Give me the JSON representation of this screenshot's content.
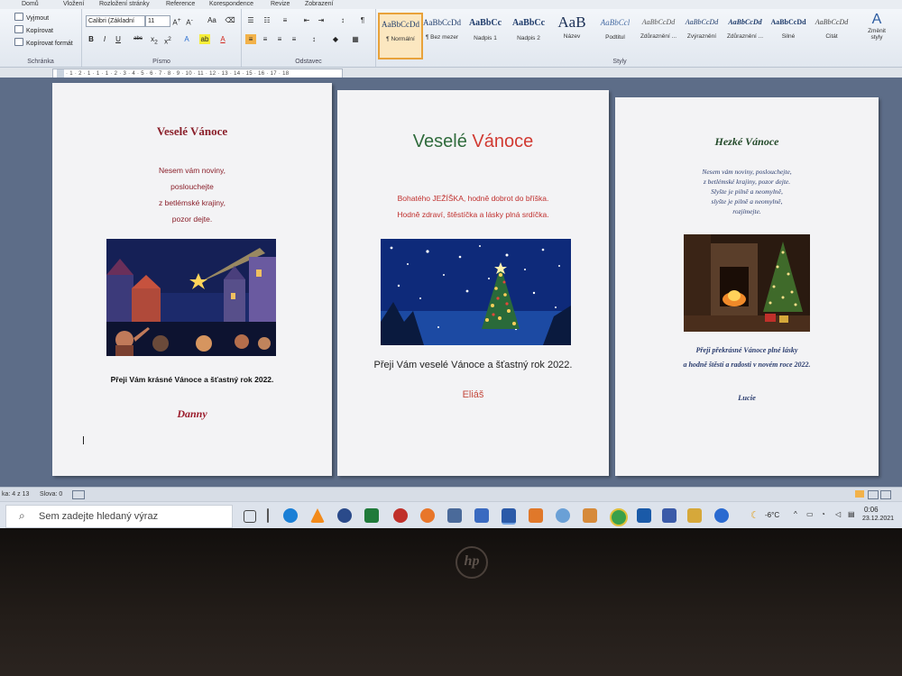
{
  "ribbon": {
    "tabs": [
      "Domů",
      "Vložení",
      "Rozložení stránky",
      "Reference",
      "Korespondence",
      "Revize",
      "Zobrazení"
    ],
    "clipboard": {
      "cut": "Vyjmout",
      "copy": "Kopírovat",
      "format_painter": "Kopírovat formát",
      "label": "Schránka"
    },
    "font": {
      "name": "Calibri (Základní",
      "size": "11",
      "label": "Písmo"
    },
    "paragraph": {
      "label": "Odstavec"
    },
    "styles": {
      "items": [
        {
          "preview": "AaBbCcDd",
          "name": "¶ Normální"
        },
        {
          "preview": "AaBbCcDd",
          "name": "¶ Bez mezer"
        },
        {
          "preview": "AaBbCc",
          "name": "Nadpis 1"
        },
        {
          "preview": "AaBbCc",
          "name": "Nadpis 2"
        },
        {
          "preview": "AaB",
          "name": "Název"
        },
        {
          "preview": "AaBbCcl",
          "name": "Podtitul"
        },
        {
          "preview": "AaBbCcDd",
          "name": "Zdůraznění ..."
        },
        {
          "preview": "AaBbCcDd",
          "name": "Zvýraznění"
        },
        {
          "preview": "AaBbCcDd",
          "name": "Zdůraznění ..."
        },
        {
          "preview": "AaBbCcDd",
          "name": "Silné"
        },
        {
          "preview": "AaBbCcDd",
          "name": "Citát"
        }
      ],
      "change": "Změnit styly",
      "label": "Styly"
    }
  },
  "ruler": "· 1 · 2 · 1 · 1 · 1 · 2 · 3 · 4 · 5 · 6 · 7 · 8 · 9 · 10 · 11 · 12 · 13 · 14 · 15 · 16 · 17 · 18",
  "page1": {
    "title": "Veselé Vánoce",
    "verse": [
      "Nesem vám noviny,",
      "poslouchejte",
      "z betlémské krajiny,",
      "pozor dejte."
    ],
    "wish": "Přeji Vám krásné Vánoce a šťastný rok 2022.",
    "signature": "Danny"
  },
  "page2": {
    "title_a": "Veselé",
    "title_b": "Vánoce",
    "line1": "Bohatého JEŽÍŠKA, hodně dobrot do bříška.",
    "line2": "Hodně zdraví, štěstíčka a lásky plná srdíčka.",
    "wish": "Přeji Vám veselé Vánoce a šťastný rok 2022.",
    "signature": "Eliáš"
  },
  "page3": {
    "title": "Hezké Vánoce",
    "verse": [
      "Nesem vám noviny, poslouchejte,",
      "z betlémské krajiny, pozor dejte.",
      "Slyšte je pilně a neomylně,",
      "slyšte je pilně a neomylně,",
      "rozjímejte."
    ],
    "wish": [
      "Přeji překrásné Vánoce plné lásky",
      "a hodně štěstí a radosti v novém roce 2022."
    ],
    "signature": "Lucie"
  },
  "status": {
    "page": "ka: 4 z 13",
    "words": "Slova: 0"
  },
  "taskbar": {
    "search_placeholder": "Sem zadejte hledaný výraz",
    "temperature": "-6°C",
    "time": "0:06",
    "date": "23.12.2021"
  },
  "colors": {
    "title_green": "#2f6b3c",
    "title_red": "#d13a32"
  }
}
